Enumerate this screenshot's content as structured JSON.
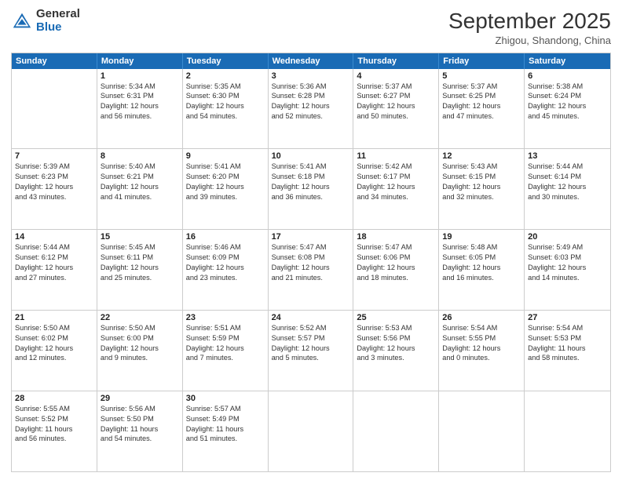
{
  "logo": {
    "general": "General",
    "blue": "Blue"
  },
  "title": "September 2025",
  "subtitle": "Zhigou, Shandong, China",
  "days": [
    "Sunday",
    "Monday",
    "Tuesday",
    "Wednesday",
    "Thursday",
    "Friday",
    "Saturday"
  ],
  "rows": [
    [
      {
        "day": "",
        "sunrise": "",
        "sunset": "",
        "daylight": ""
      },
      {
        "day": "1",
        "sunrise": "Sunrise: 5:34 AM",
        "sunset": "Sunset: 6:31 PM",
        "daylight": "Daylight: 12 hours and 56 minutes."
      },
      {
        "day": "2",
        "sunrise": "Sunrise: 5:35 AM",
        "sunset": "Sunset: 6:30 PM",
        "daylight": "Daylight: 12 hours and 54 minutes."
      },
      {
        "day": "3",
        "sunrise": "Sunrise: 5:36 AM",
        "sunset": "Sunset: 6:28 PM",
        "daylight": "Daylight: 12 hours and 52 minutes."
      },
      {
        "day": "4",
        "sunrise": "Sunrise: 5:37 AM",
        "sunset": "Sunset: 6:27 PM",
        "daylight": "Daylight: 12 hours and 50 minutes."
      },
      {
        "day": "5",
        "sunrise": "Sunrise: 5:37 AM",
        "sunset": "Sunset: 6:25 PM",
        "daylight": "Daylight: 12 hours and 47 minutes."
      },
      {
        "day": "6",
        "sunrise": "Sunrise: 5:38 AM",
        "sunset": "Sunset: 6:24 PM",
        "daylight": "Daylight: 12 hours and 45 minutes."
      }
    ],
    [
      {
        "day": "7",
        "sunrise": "Sunrise: 5:39 AM",
        "sunset": "Sunset: 6:23 PM",
        "daylight": "Daylight: 12 hours and 43 minutes."
      },
      {
        "day": "8",
        "sunrise": "Sunrise: 5:40 AM",
        "sunset": "Sunset: 6:21 PM",
        "daylight": "Daylight: 12 hours and 41 minutes."
      },
      {
        "day": "9",
        "sunrise": "Sunrise: 5:41 AM",
        "sunset": "Sunset: 6:20 PM",
        "daylight": "Daylight: 12 hours and 39 minutes."
      },
      {
        "day": "10",
        "sunrise": "Sunrise: 5:41 AM",
        "sunset": "Sunset: 6:18 PM",
        "daylight": "Daylight: 12 hours and 36 minutes."
      },
      {
        "day": "11",
        "sunrise": "Sunrise: 5:42 AM",
        "sunset": "Sunset: 6:17 PM",
        "daylight": "Daylight: 12 hours and 34 minutes."
      },
      {
        "day": "12",
        "sunrise": "Sunrise: 5:43 AM",
        "sunset": "Sunset: 6:15 PM",
        "daylight": "Daylight: 12 hours and 32 minutes."
      },
      {
        "day": "13",
        "sunrise": "Sunrise: 5:44 AM",
        "sunset": "Sunset: 6:14 PM",
        "daylight": "Daylight: 12 hours and 30 minutes."
      }
    ],
    [
      {
        "day": "14",
        "sunrise": "Sunrise: 5:44 AM",
        "sunset": "Sunset: 6:12 PM",
        "daylight": "Daylight: 12 hours and 27 minutes."
      },
      {
        "day": "15",
        "sunrise": "Sunrise: 5:45 AM",
        "sunset": "Sunset: 6:11 PM",
        "daylight": "Daylight: 12 hours and 25 minutes."
      },
      {
        "day": "16",
        "sunrise": "Sunrise: 5:46 AM",
        "sunset": "Sunset: 6:09 PM",
        "daylight": "Daylight: 12 hours and 23 minutes."
      },
      {
        "day": "17",
        "sunrise": "Sunrise: 5:47 AM",
        "sunset": "Sunset: 6:08 PM",
        "daylight": "Daylight: 12 hours and 21 minutes."
      },
      {
        "day": "18",
        "sunrise": "Sunrise: 5:47 AM",
        "sunset": "Sunset: 6:06 PM",
        "daylight": "Daylight: 12 hours and 18 minutes."
      },
      {
        "day": "19",
        "sunrise": "Sunrise: 5:48 AM",
        "sunset": "Sunset: 6:05 PM",
        "daylight": "Daylight: 12 hours and 16 minutes."
      },
      {
        "day": "20",
        "sunrise": "Sunrise: 5:49 AM",
        "sunset": "Sunset: 6:03 PM",
        "daylight": "Daylight: 12 hours and 14 minutes."
      }
    ],
    [
      {
        "day": "21",
        "sunrise": "Sunrise: 5:50 AM",
        "sunset": "Sunset: 6:02 PM",
        "daylight": "Daylight: 12 hours and 12 minutes."
      },
      {
        "day": "22",
        "sunrise": "Sunrise: 5:50 AM",
        "sunset": "Sunset: 6:00 PM",
        "daylight": "Daylight: 12 hours and 9 minutes."
      },
      {
        "day": "23",
        "sunrise": "Sunrise: 5:51 AM",
        "sunset": "Sunset: 5:59 PM",
        "daylight": "Daylight: 12 hours and 7 minutes."
      },
      {
        "day": "24",
        "sunrise": "Sunrise: 5:52 AM",
        "sunset": "Sunset: 5:57 PM",
        "daylight": "Daylight: 12 hours and 5 minutes."
      },
      {
        "day": "25",
        "sunrise": "Sunrise: 5:53 AM",
        "sunset": "Sunset: 5:56 PM",
        "daylight": "Daylight: 12 hours and 3 minutes."
      },
      {
        "day": "26",
        "sunrise": "Sunrise: 5:54 AM",
        "sunset": "Sunset: 5:55 PM",
        "daylight": "Daylight: 12 hours and 0 minutes."
      },
      {
        "day": "27",
        "sunrise": "Sunrise: 5:54 AM",
        "sunset": "Sunset: 5:53 PM",
        "daylight": "Daylight: 11 hours and 58 minutes."
      }
    ],
    [
      {
        "day": "28",
        "sunrise": "Sunrise: 5:55 AM",
        "sunset": "Sunset: 5:52 PM",
        "daylight": "Daylight: 11 hours and 56 minutes."
      },
      {
        "day": "29",
        "sunrise": "Sunrise: 5:56 AM",
        "sunset": "Sunset: 5:50 PM",
        "daylight": "Daylight: 11 hours and 54 minutes."
      },
      {
        "day": "30",
        "sunrise": "Sunrise: 5:57 AM",
        "sunset": "Sunset: 5:49 PM",
        "daylight": "Daylight: 11 hours and 51 minutes."
      },
      {
        "day": "",
        "sunrise": "",
        "sunset": "",
        "daylight": ""
      },
      {
        "day": "",
        "sunrise": "",
        "sunset": "",
        "daylight": ""
      },
      {
        "day": "",
        "sunrise": "",
        "sunset": "",
        "daylight": ""
      },
      {
        "day": "",
        "sunrise": "",
        "sunset": "",
        "daylight": ""
      }
    ]
  ]
}
